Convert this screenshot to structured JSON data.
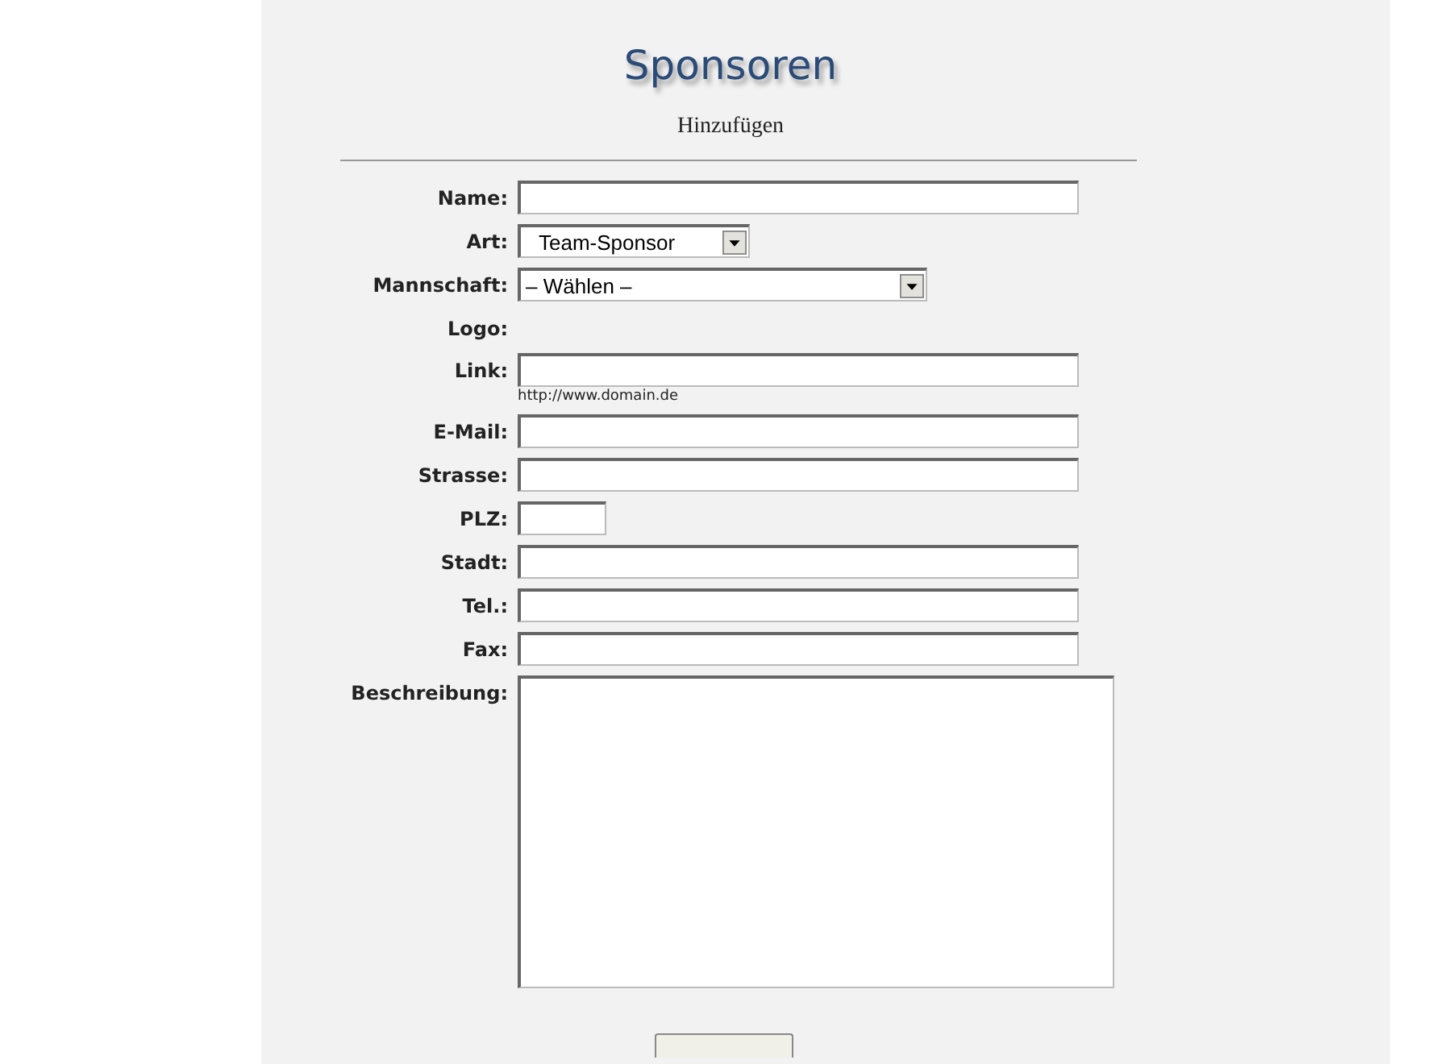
{
  "title": "Sponsoren",
  "subtitle": "Hinzufügen",
  "fields": [
    {
      "label": "Name:",
      "kind": "text"
    },
    {
      "label": "Art:",
      "kind": "select",
      "value": "Team-Sponsor"
    },
    {
      "label": "Mannschaft:",
      "kind": "wide-select",
      "value": "– Wählen –"
    },
    {
      "label": "Logo:",
      "kind": "none"
    },
    {
      "label": "Link:",
      "kind": "text",
      "hint": "http://www.domain.de"
    },
    {
      "label": "E-Mail:",
      "kind": "text"
    },
    {
      "label": "Strasse:",
      "kind": "text"
    },
    {
      "label": "PLZ:",
      "kind": "short-text"
    },
    {
      "label": "Stadt:",
      "kind": "text"
    },
    {
      "label": "Tel.:",
      "kind": "text"
    },
    {
      "label": "Fax:",
      "kind": "text"
    },
    {
      "label": "Beschreibung:",
      "kind": "textarea"
    }
  ]
}
